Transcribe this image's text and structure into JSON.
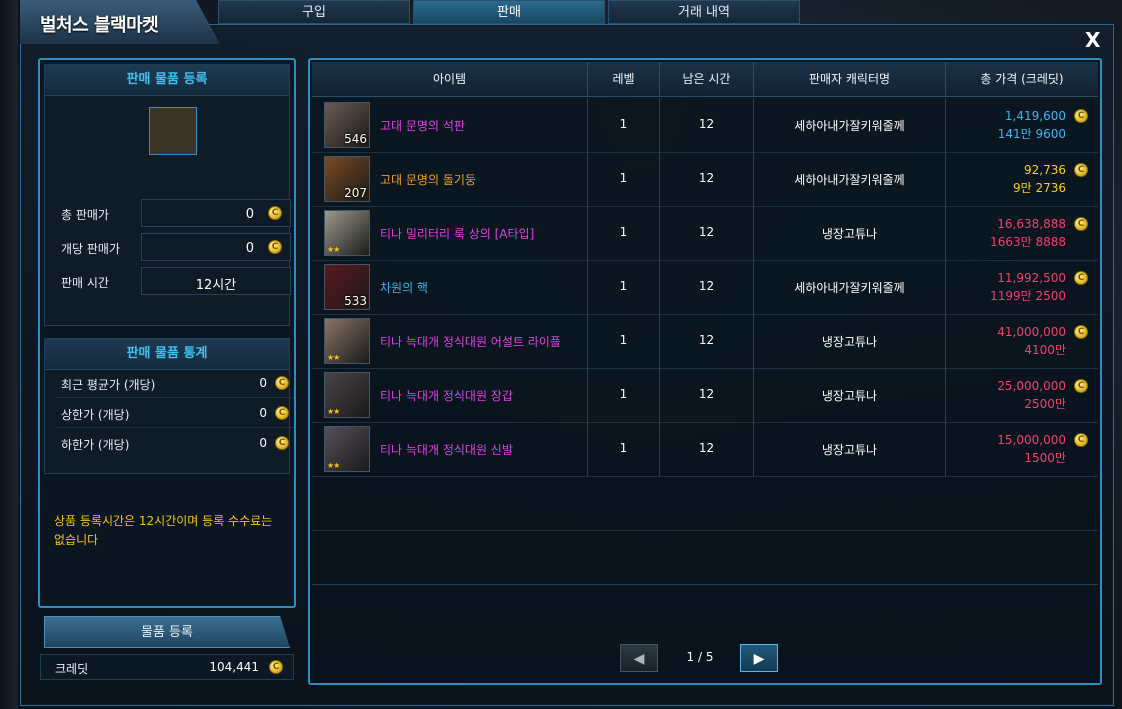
{
  "window": {
    "title": "벌처스 블랙마켓",
    "close_label": "X",
    "tabs": [
      {
        "label": "구입",
        "active": false
      },
      {
        "label": "판매",
        "active": true
      },
      {
        "label": "거래 내역",
        "active": false
      }
    ]
  },
  "left": {
    "register_section_title": "판매 물품 등록",
    "total_price_label": "총 판매가",
    "total_price_value": "0",
    "unit_price_label": "개당 판매가",
    "unit_price_value": "0",
    "sale_time_label": "판매 시간",
    "sale_time_value": "12시간",
    "stats_section_title": "판매 물품 통계",
    "stats": [
      {
        "label": "최근 평균가 (개당)",
        "value": "0"
      },
      {
        "label": "상한가 (개당)",
        "value": "0"
      },
      {
        "label": "하한가 (개당)",
        "value": "0"
      }
    ],
    "notice": "상품 등록시간은 12시간이며 등록 수수료는 없습니다",
    "register_button": "물품 등록",
    "credit_label": "크레딧",
    "credit_value": "104,441"
  },
  "table": {
    "headers": [
      "아이템",
      "레벨",
      "남은 시간",
      "판매자 캐릭터명",
      "총 가격 (크레딧)"
    ],
    "rows": [
      {
        "icon": "stone-tablet-icon",
        "name": "고대 문명의 석판",
        "name_color": "#e040e0",
        "qty": "546",
        "stars": "",
        "level": "1",
        "time": "12",
        "seller": "세하아내가잘키워줄께",
        "price": "1,419,600",
        "price_kr": "141만 9600",
        "price_color": "#3ab8f0",
        "price_kr_color": "#3ab8f0",
        "icon_bg": "#6a5a52"
      },
      {
        "icon": "stone-pillar-icon",
        "name": "고대 문명의 돌기둥",
        "name_color": "#f0a020",
        "qty": "207",
        "stars": "",
        "level": "1",
        "time": "12",
        "seller": "세하아내가잘키워줄께",
        "price": "92,736",
        "price_kr": "9만 2736",
        "price_color": "#f5d020",
        "price_kr_color": "#f5d020",
        "icon_bg": "#7a4a22"
      },
      {
        "icon": "military-vest-icon",
        "name": "티나 밀리터리 룩 상의 [A타입]",
        "name_color": "#e040e0",
        "qty": "",
        "stars": "★★",
        "level": "1",
        "time": "12",
        "seller": "냉장고튜나",
        "price": "16,638,888",
        "price_kr": "1663만 8888",
        "price_color": "#f04070",
        "price_kr_color": "#f04070",
        "icon_bg": "#9c9a8c"
      },
      {
        "icon": "dimension-core-icon",
        "name": "차원의 핵",
        "name_color": "#3ab8f0",
        "qty": "533",
        "stars": "",
        "level": "1",
        "time": "12",
        "seller": "세하아내가잘키워줄께",
        "price": "11,992,500",
        "price_kr": "1199만 2500",
        "price_color": "#f04070",
        "price_kr_color": "#f04070",
        "icon_bg": "#5a1820"
      },
      {
        "icon": "assault-rifle-icon",
        "name": "티나 늑대개 정식대원 어설트 라이플",
        "name_color": "#e040e0",
        "qty": "",
        "stars": "★★",
        "level": "1",
        "time": "12",
        "seller": "냉장고튜나",
        "price": "41,000,000",
        "price_kr": "4100만",
        "price_color": "#f04070",
        "price_kr_color": "#f04070",
        "icon_bg": "#8a7466"
      },
      {
        "icon": "gloves-icon",
        "name": "티나 늑대개 정식대원 장갑",
        "name_color": "#e040e0",
        "qty": "",
        "stars": "★★",
        "level": "1",
        "time": "12",
        "seller": "냉장고튜나",
        "price": "25,000,000",
        "price_kr": "2500만",
        "price_color": "#f04070",
        "price_kr_color": "#f04070",
        "icon_bg": "#4a4448"
      },
      {
        "icon": "shoes-icon",
        "name": "티나 늑대개 정식대원 신발",
        "name_color": "#e040e0",
        "qty": "",
        "stars": "★★",
        "level": "1",
        "time": "12",
        "seller": "냉장고튜나",
        "price": "15,000,000",
        "price_kr": "1500만",
        "price_color": "#f04070",
        "price_kr_color": "#f04070",
        "icon_bg": "#55505a"
      }
    ]
  },
  "pager": {
    "prev_label": "◀",
    "next_label": "▶",
    "page_text": "1 / 5"
  }
}
